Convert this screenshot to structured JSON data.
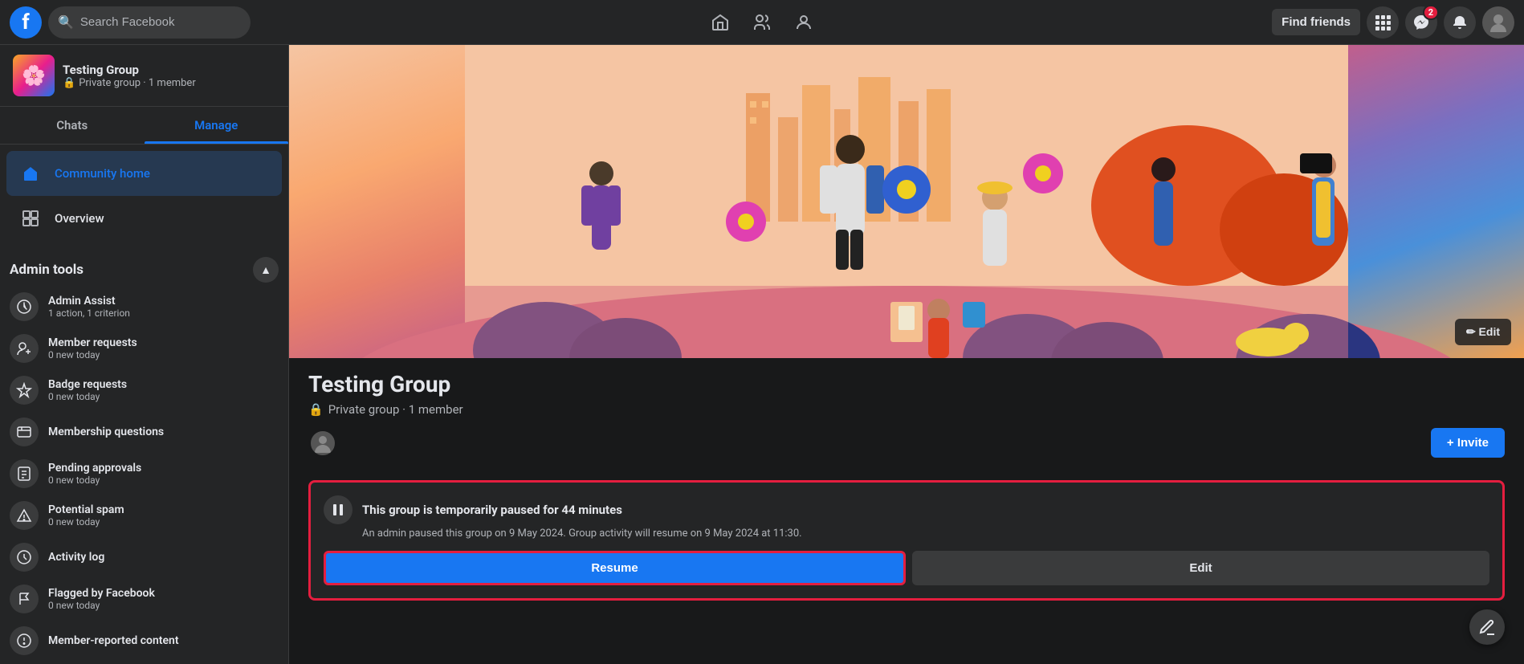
{
  "topnav": {
    "logo_text": "f",
    "search_placeholder": "Search Facebook",
    "find_friends_label": "Find friends",
    "nav_icons": [
      {
        "name": "home-icon",
        "symbol": "⌂",
        "active": false
      },
      {
        "name": "people-icon",
        "symbol": "👥",
        "active": false
      },
      {
        "name": "profile-icon",
        "symbol": "👤",
        "active": false
      }
    ],
    "messenger_badge": "2",
    "notification_icon": "🔔",
    "grid_icon": "⊞"
  },
  "sidebar": {
    "group_name": "Testing Group",
    "group_meta": "Private group · 1 member",
    "group_emoji": "🎨",
    "tab_chats": "Chats",
    "tab_manage": "Manage",
    "active_tab": "Manage",
    "nav_items": [
      {
        "name": "Community home",
        "icon": "🏠",
        "active": true
      },
      {
        "name": "Overview",
        "icon": "◻",
        "active": false
      }
    ],
    "admin_tools_label": "Admin tools",
    "admin_tools": [
      {
        "name": "Admin Assist",
        "sub": "1 action, 1 criterion",
        "icon": "⚙"
      },
      {
        "name": "Member requests",
        "sub": "0 new today",
        "icon": "👤"
      },
      {
        "name": "Badge requests",
        "sub": "0 new today",
        "icon": "🛡"
      },
      {
        "name": "Membership questions",
        "sub": "",
        "icon": "❓"
      },
      {
        "name": "Pending approvals",
        "sub": "0 new today",
        "icon": "📋"
      },
      {
        "name": "Potential spam",
        "sub": "0 new today",
        "icon": "⚠"
      },
      {
        "name": "Activity log",
        "sub": "",
        "icon": "📄"
      },
      {
        "name": "Flagged by Facebook",
        "sub": "0 new today",
        "icon": "🚩"
      },
      {
        "name": "Member-reported content",
        "sub": "",
        "icon": "🚨"
      }
    ]
  },
  "main": {
    "group_name": "Testing Group",
    "group_meta_lock": "🔒",
    "group_meta_text": "Private group · 1 member",
    "edit_cover_label": "✏ Edit",
    "invite_label": "+ Invite",
    "pause_title": "This group is temporarily paused for 44 minutes",
    "pause_sub": "An admin paused this group on 9 May 2024. Group activity will resume on 9 May 2024 at 11:30.",
    "resume_label": "Resume",
    "edit_label": "Edit"
  }
}
